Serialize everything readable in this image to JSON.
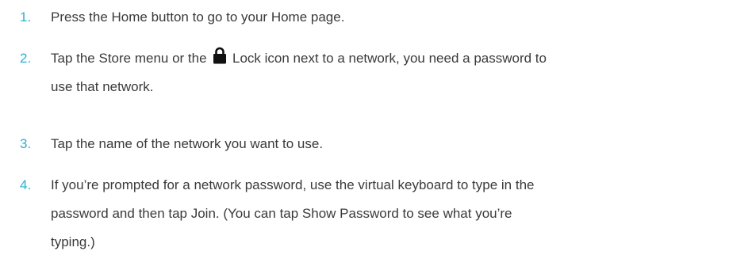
{
  "steps": [
    {
      "number": "1.",
      "lines": [
        "Press the Home button to go to your Home page."
      ]
    },
    {
      "number": "2.",
      "before_icon": "Tap the Store menu or the ",
      "after_icon": " Lock icon next to a network, you need a password to",
      "line2": "use that network.",
      "icon": "lock-icon"
    },
    {
      "number": "3.",
      "lines": [
        "Tap the name of the network you want to use."
      ]
    },
    {
      "number": "4.",
      "lines": [
        "If you’re prompted for a network password, use the virtual keyboard to type in the",
        "password and then tap Join.  (You can tap Show Password to see what you’re",
        "typing.)"
      ]
    }
  ],
  "colors": {
    "number": "#2ab0d6",
    "text": "#3a3a3a"
  }
}
